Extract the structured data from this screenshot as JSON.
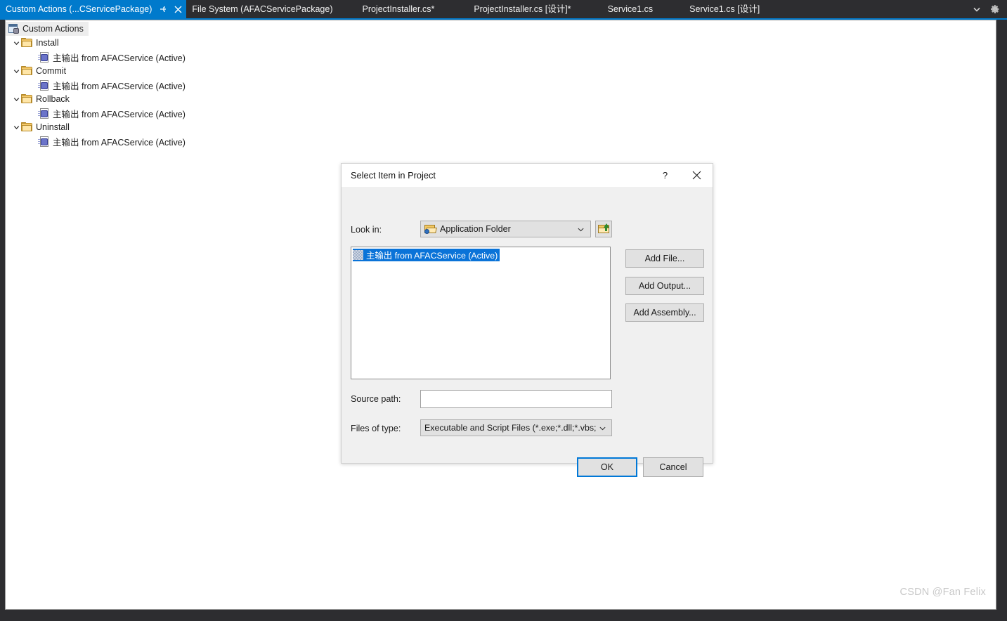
{
  "tabstrip": {
    "tabs": [
      {
        "label": "Custom Actions (...CServicePackage)",
        "active": true,
        "pin_icon": "pin-icon",
        "close_icon": "close-icon"
      },
      {
        "label": "File System (AFACServicePackage)",
        "active": false
      },
      {
        "label": "ProjectInstaller.cs*",
        "active": false
      },
      {
        "label": "ProjectInstaller.cs [设计]*",
        "active": false
      },
      {
        "label": "Service1.cs",
        "active": false
      },
      {
        "label": "Service1.cs [设计]",
        "active": false
      }
    ],
    "tools": [
      {
        "icon": "chevron-down-icon",
        "name": "tab-list-dropdown"
      },
      {
        "icon": "gear-icon",
        "name": "tab-options-gear"
      }
    ],
    "active_color": "#007acc",
    "background_color": "#2d2d30",
    "underline_color": "#007acc"
  },
  "designer": {
    "root": {
      "label": "Custom Actions",
      "icon": "custom-actions-root-icon"
    },
    "item_label": "主输出 from AFACService (Active)",
    "folders": [
      {
        "label": "Install",
        "expanded": true,
        "children": [
          "主输出 from AFACService (Active)"
        ]
      },
      {
        "label": "Commit",
        "expanded": true,
        "children": [
          "主输出 from AFACService (Active)"
        ]
      },
      {
        "label": "Rollback",
        "expanded": true,
        "children": [
          "主输出 from AFACService (Active)"
        ]
      },
      {
        "label": "Uninstall",
        "expanded": true,
        "children": [
          "主输出 from AFACService (Active)"
        ]
      }
    ]
  },
  "watermark": {
    "text": "CSDN @Fan Felix"
  },
  "dialog": {
    "title": "Select Item in Project",
    "titlebar_buttons": [
      {
        "name": "help-button",
        "icon": "question-mark-icon",
        "label": "?"
      },
      {
        "name": "close-button",
        "icon": "close-icon",
        "label": "✕"
      }
    ],
    "look_in": {
      "label": "Look in:",
      "value": "Application Folder",
      "icon": "open-folder-icon",
      "arrow_icon": "chevron-down-icon"
    },
    "up_folder_button": {
      "name": "up-one-level-button",
      "icon": "up-folder-icon"
    },
    "list": {
      "items": [
        {
          "label": "主输出 from AFACService (Active)",
          "selected": true,
          "icon": "primary-output-icon"
        }
      ],
      "selection_color": "#0a73d8"
    },
    "side_buttons": [
      {
        "name": "add-file-button",
        "label": "Add File..."
      },
      {
        "name": "add-output-button",
        "label": "Add Output..."
      },
      {
        "name": "add-assembly-button",
        "label": "Add Assembly..."
      }
    ],
    "source_path": {
      "label": "Source path:",
      "value": "",
      "placeholder": ""
    },
    "files_of_type": {
      "label": "Files of type:",
      "value": "Executable and Script Files (*.exe;*.dll;*.vbs;",
      "arrow_icon": "chevron-down-icon"
    },
    "footer_buttons": [
      {
        "name": "ok-button",
        "label": "OK",
        "default": true,
        "focus_color": "#0078d7"
      },
      {
        "name": "cancel-button",
        "label": "Cancel",
        "default": false
      }
    ]
  }
}
